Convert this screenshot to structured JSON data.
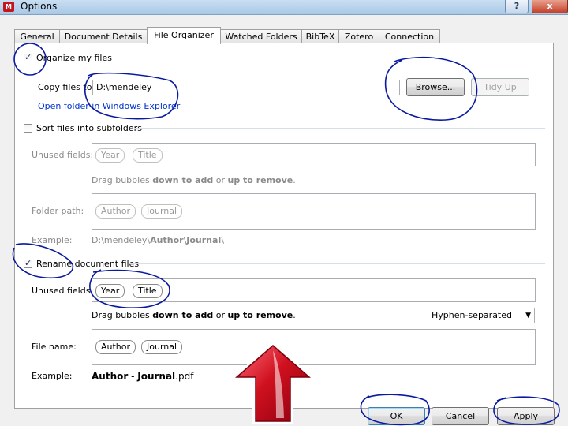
{
  "window": {
    "title": "Options",
    "app_icon_text": "M",
    "help_label": "?",
    "close_label": "x"
  },
  "tabs": [
    "General",
    "Document Details",
    "File Organizer",
    "Watched Folders",
    "BibTeX",
    "Zotero",
    "Connection"
  ],
  "organize": {
    "label": "Organize my files",
    "checked": true,
    "copy_label": "Copy files to:",
    "path_value": "D:\\mendeley",
    "browse_label": "Browse...",
    "tidy_label": "Tidy Up",
    "open_folder_link": "Open folder in Windows Explorer"
  },
  "sort": {
    "label": "Sort files into subfolders",
    "checked": false,
    "unused_label": "Unused fields:",
    "unused_bubbles": [
      "Year",
      "Title"
    ],
    "drag_prefix": "Drag bubbles ",
    "drag_down": "down to add",
    "drag_or": " or ",
    "drag_up": "up to remove",
    "drag_end": ".",
    "folder_label": "Folder path:",
    "folder_bubbles": [
      "Author",
      "Journal"
    ],
    "example_label": "Example:",
    "example_prefix": "D:\\mendeley\\",
    "example_bold1": "Author",
    "example_sep": "\\",
    "example_bold2": "Journal",
    "example_suffix": "\\"
  },
  "rename": {
    "label": "Rename document files",
    "checked": true,
    "unused_label": "Unused fields:",
    "unused_bubbles": [
      "Year",
      "Title"
    ],
    "drag_prefix": "Drag bubbles ",
    "drag_down": "down to add",
    "drag_or": " or ",
    "drag_up": "up to remove",
    "drag_end": ".",
    "separator_value": "Hyphen-separated",
    "filename_label": "File name:",
    "filename_bubbles": [
      "Author",
      "Journal"
    ],
    "example_label": "Example:",
    "example_bold1": "Author",
    "example_sep": " - ",
    "example_bold2": "Journal",
    "example_suffix": ".pdf"
  },
  "footer": {
    "ok_label": "OK",
    "cancel_label": "Cancel",
    "apply_label": "Apply"
  },
  "colors": {
    "annotation_ink": "#0a1aa0",
    "arrow_red": "#d0101e",
    "link_blue": "#0033cc"
  }
}
